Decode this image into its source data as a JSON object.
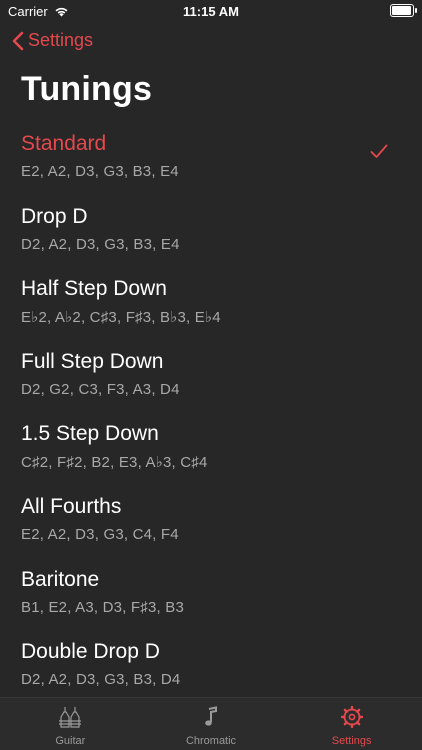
{
  "status": {
    "carrier": "Carrier",
    "time": "11:15 AM"
  },
  "nav": {
    "back_label": "Settings"
  },
  "title": "Tunings",
  "tunings": [
    {
      "name": "Standard",
      "notes": "E2, A2, D3, G3, B3, E4",
      "selected": true
    },
    {
      "name": "Drop D",
      "notes": "D2, A2, D3, G3, B3, E4",
      "selected": false
    },
    {
      "name": "Half Step Down",
      "notes": "E♭2, A♭2, C♯3, F♯3, B♭3, E♭4",
      "selected": false
    },
    {
      "name": "Full Step Down",
      "notes": "D2, G2, C3, F3, A3, D4",
      "selected": false
    },
    {
      "name": "1.5 Step Down",
      "notes": "C♯2, F♯2, B2, E3, A♭3, C♯4",
      "selected": false
    },
    {
      "name": "All Fourths",
      "notes": "E2, A2, D3, G3, C4, F4",
      "selected": false
    },
    {
      "name": "Baritone",
      "notes": "B1, E2, A3, D3, F♯3, B3",
      "selected": false
    },
    {
      "name": "Double Drop D",
      "notes": "D2, A2, D3, G3, B3, D4",
      "selected": false
    }
  ],
  "tabs": [
    {
      "label": "Guitar",
      "icon": "guitar-icon",
      "active": false
    },
    {
      "label": "Chromatic",
      "icon": "music-note-icon",
      "active": false
    },
    {
      "label": "Settings",
      "icon": "gear-icon",
      "active": true
    }
  ],
  "colors": {
    "accent": "#e5484d",
    "background": "#272727",
    "secondary_text": "#a8a8a8"
  }
}
